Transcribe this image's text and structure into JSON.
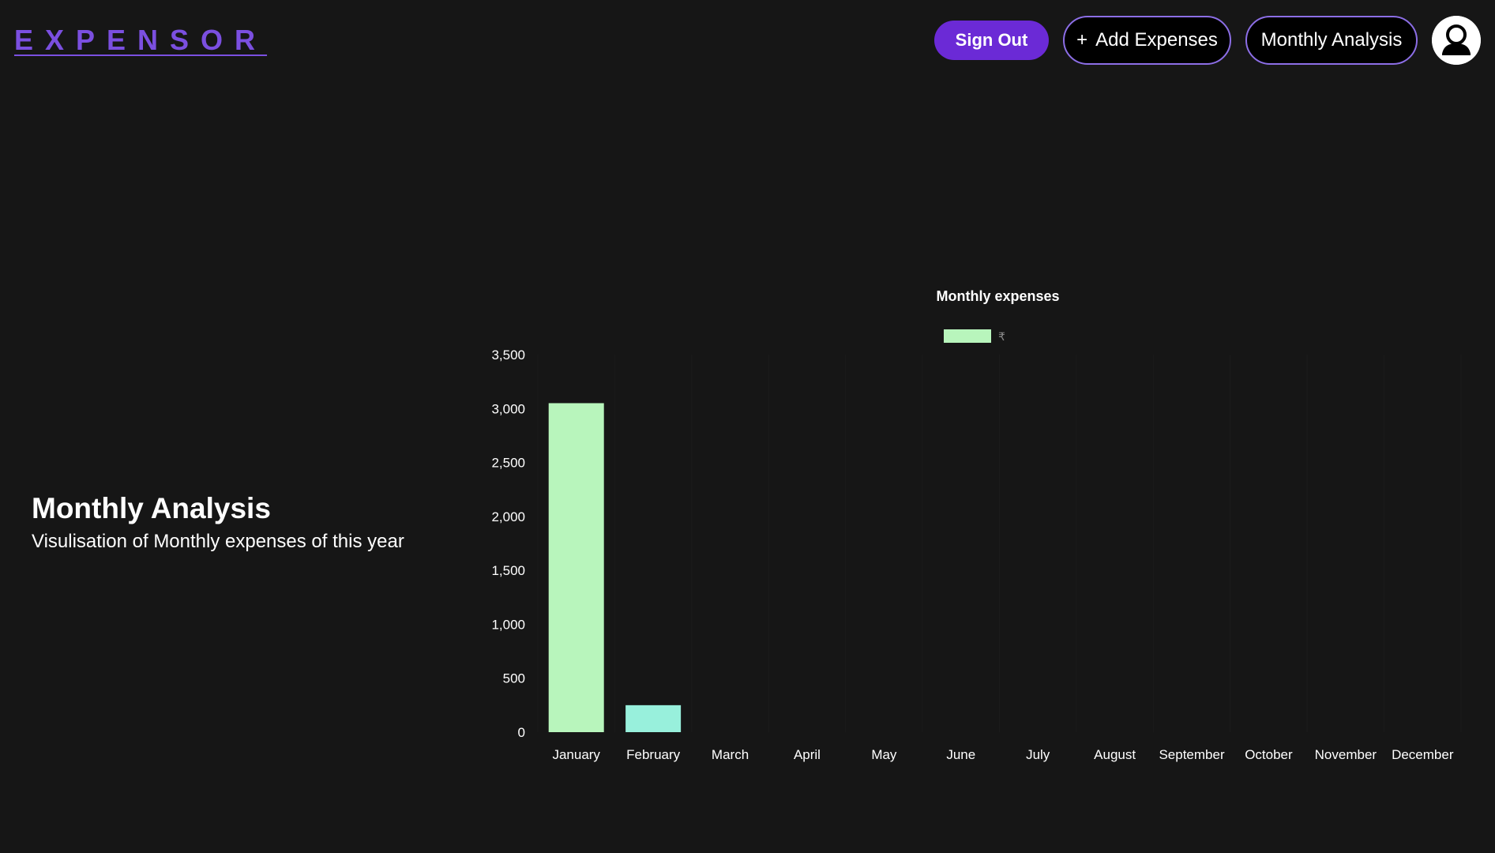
{
  "header": {
    "logo": "EXPENSOR",
    "sign_out_label": "Sign Out",
    "add_expenses_icon": "+",
    "add_expenses_label": "Add Expenses",
    "monthly_analysis_label": "Monthly Analysis",
    "avatar_icon": "user-avatar-icon"
  },
  "main": {
    "title": "Monthly Analysis",
    "subtitle": "Visulisation of Monthly expenses of this year"
  },
  "colors": {
    "background": "#161616",
    "accent": "#6b2ad6",
    "logo": "#7b4fe0",
    "button_border": "#8c6ee6",
    "bar_january": "#b8f5bc",
    "bar_february": "#98f0dc",
    "legend_swatch": "#b8f5bc"
  },
  "chart_data": {
    "type": "bar",
    "title": "Monthly expenses",
    "categories": [
      "January",
      "February",
      "March",
      "April",
      "May",
      "June",
      "July",
      "August",
      "September",
      "October",
      "November",
      "December"
    ],
    "series": [
      {
        "name": "₹",
        "values": [
          3050,
          250,
          0,
          0,
          0,
          0,
          0,
          0,
          0,
          0,
          0,
          0
        ]
      }
    ],
    "ylim": [
      0,
      3500
    ],
    "yticks": [
      "0",
      "500",
      "1,000",
      "1,500",
      "2,000",
      "2,500",
      "3,000",
      "3,500"
    ],
    "ytick_values": [
      0,
      500,
      1000,
      1500,
      2000,
      2500,
      3000,
      3500
    ],
    "legend_position": "top",
    "grid": true
  }
}
